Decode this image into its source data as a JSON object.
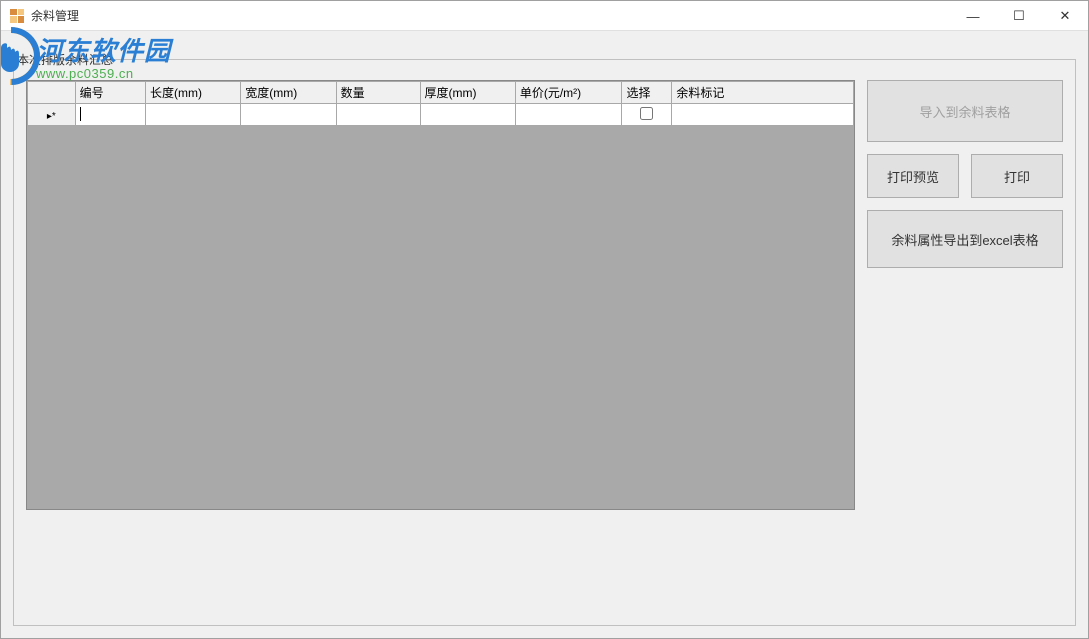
{
  "window": {
    "title": "余料管理"
  },
  "watermark": {
    "name_cn": "河东软件园",
    "url": "www.pc0359.cn"
  },
  "section": {
    "label": "本次排版余料汇总"
  },
  "table": {
    "headers": {
      "id": "编号",
      "length": "长度(mm)",
      "width": "宽度(mm)",
      "quantity": "数量",
      "thickness": "厚度(mm)",
      "price": "单价(元/m²)",
      "select": "选择",
      "mark": "余料标记"
    },
    "new_row_indicator": "▸*"
  },
  "buttons": {
    "import": "导入到余料表格",
    "print_preview": "打印预览",
    "print": "打印",
    "export_excel": "余料属性导出到excel表格"
  },
  "window_controls": {
    "minimize": "—",
    "maximize": "☐",
    "close": "✕"
  }
}
